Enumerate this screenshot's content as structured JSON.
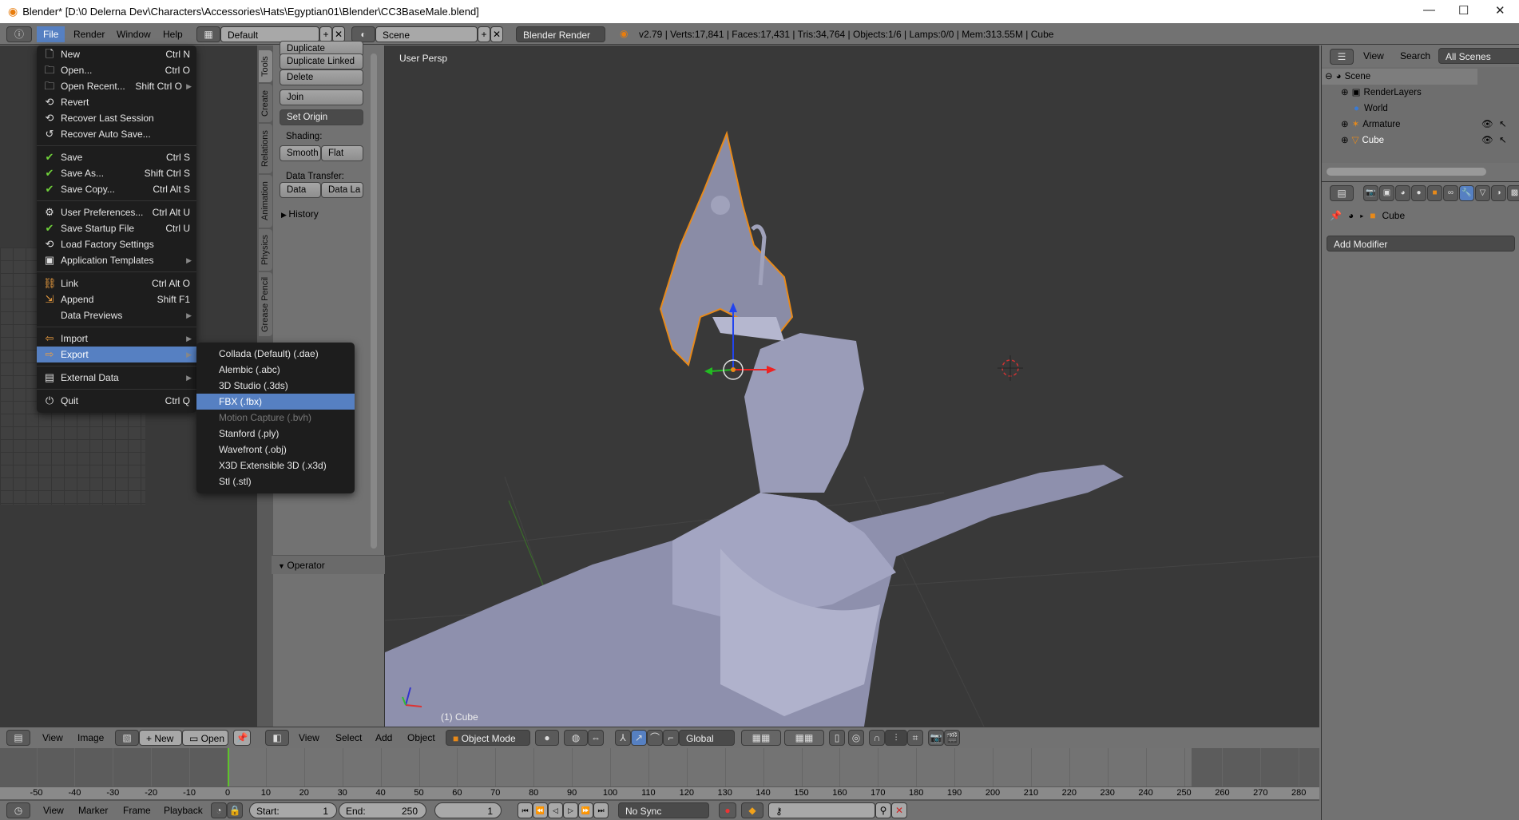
{
  "window": {
    "title": "Blender* [D:\\0 Delerna Dev\\Characters\\Accessories\\Hats\\Egyptian01\\Blender\\CC3BaseMale.blend]",
    "minimize": "—",
    "maximize": "☐",
    "close": "✕"
  },
  "menubar": {
    "items": [
      "File",
      "Render",
      "Window",
      "Help"
    ],
    "active": "File",
    "layout": "Default",
    "scene": "Scene",
    "engine": "Blender Render"
  },
  "stats": "v2.79 | Verts:17,841 | Faces:17,431 | Tris:34,764 | Objects:1/6 | Lamps:0/0 | Mem:313.55M | Cube",
  "file_menu": {
    "groups": [
      [
        {
          "label": "New",
          "shortcut": "Ctrl N",
          "icon": "new-file-icon"
        },
        {
          "label": "Open...",
          "shortcut": "Ctrl O",
          "icon": "folder-icon"
        },
        {
          "label": "Open Recent...",
          "shortcut": "Shift Ctrl O",
          "icon": "recent-icon",
          "submenu": true
        },
        {
          "label": "Revert",
          "shortcut": "",
          "icon": "revert-icon"
        },
        {
          "label": "Recover Last Session",
          "shortcut": "",
          "icon": "recover-icon"
        },
        {
          "label": "Recover Auto Save...",
          "shortcut": "",
          "icon": "recover-auto-icon"
        }
      ],
      [
        {
          "label": "Save",
          "shortcut": "Ctrl S",
          "icon": "check-icon"
        },
        {
          "label": "Save As...",
          "shortcut": "Shift Ctrl S",
          "icon": "check-icon"
        },
        {
          "label": "Save Copy...",
          "shortcut": "Ctrl Alt S",
          "icon": "check-icon"
        }
      ],
      [
        {
          "label": "User Preferences...",
          "shortcut": "Ctrl Alt U",
          "icon": "preferences-icon"
        },
        {
          "label": "Save Startup File",
          "shortcut": "Ctrl U",
          "icon": "save-startup-icon"
        },
        {
          "label": "Load Factory Settings",
          "shortcut": "",
          "icon": "factory-icon"
        },
        {
          "label": "Application Templates",
          "shortcut": "",
          "icon": "template-icon",
          "submenu": true
        }
      ],
      [
        {
          "label": "Link",
          "shortcut": "Ctrl Alt O",
          "icon": "link-icon"
        },
        {
          "label": "Append",
          "shortcut": "Shift F1",
          "icon": "append-icon"
        },
        {
          "label": "Data Previews",
          "shortcut": "",
          "icon": "",
          "submenu": true
        }
      ],
      [
        {
          "label": "Import",
          "shortcut": "",
          "icon": "import-icon",
          "submenu": true
        },
        {
          "label": "Export",
          "shortcut": "",
          "icon": "export-icon",
          "submenu": true,
          "selected": true
        }
      ],
      [
        {
          "label": "External Data",
          "shortcut": "",
          "icon": "external-data-icon",
          "submenu": true
        }
      ],
      [
        {
          "label": "Quit",
          "shortcut": "Ctrl Q",
          "icon": "power-icon"
        }
      ]
    ]
  },
  "export_menu": [
    {
      "label": "Collada (Default) (.dae)"
    },
    {
      "label": "Alembic (.abc)"
    },
    {
      "label": "3D Studio (.3ds)"
    },
    {
      "label": "FBX (.fbx)",
      "selected": true
    },
    {
      "label": "Motion Capture (.bvh)",
      "disabled": true
    },
    {
      "label": "Stanford (.ply)"
    },
    {
      "label": "Wavefront (.obj)"
    },
    {
      "label": "X3D Extensible 3D (.x3d)"
    },
    {
      "label": "Stl (.stl)"
    }
  ],
  "toolshelf": {
    "tabs": [
      "Tools",
      "Create",
      "Relations",
      "Animation",
      "Physics",
      "Grease Pencil"
    ],
    "duplicate": "Duplicate",
    "duplicate_linked": "Duplicate Linked",
    "delete": "Delete",
    "join": "Join",
    "set_origin": "Set Origin",
    "shading_label": "Shading:",
    "smooth": "Smooth",
    "flat": "Flat",
    "data_transfer_label": "Data Transfer:",
    "data": "Data",
    "data_layout": "Data La",
    "history": "History",
    "operator": "Operator"
  },
  "viewport": {
    "view_name": "User Persp",
    "object_label": "(1) Cube"
  },
  "outliner": {
    "view": "View",
    "search": "Search",
    "filter": "All Scenes",
    "rows": [
      {
        "label": "Scene",
        "icon": "scene-icon"
      },
      {
        "label": "RenderLayers",
        "icon": "render-layers-icon"
      },
      {
        "label": "World",
        "icon": "world-icon"
      },
      {
        "label": "Armature",
        "icon": "armature-icon"
      },
      {
        "label": "Cube",
        "icon": "mesh-icon"
      }
    ]
  },
  "properties": {
    "object": "Cube",
    "add_modifier": "Add Modifier",
    "active_tab": "modifiers"
  },
  "image_header": {
    "view": "View",
    "image": "Image",
    "new": "New",
    "open": "Open"
  },
  "view3d_header": {
    "view": "View",
    "select": "Select",
    "add": "Add",
    "object": "Object",
    "mode": "Object Mode",
    "orientation": "Global"
  },
  "timeline": {
    "ticks": [
      -50,
      -40,
      -30,
      -20,
      -10,
      0,
      10,
      20,
      30,
      40,
      50,
      60,
      70,
      80,
      90,
      100,
      110,
      120,
      130,
      140,
      150,
      160,
      170,
      180,
      190,
      200,
      210,
      220,
      230,
      240,
      250,
      260,
      270,
      280
    ],
    "current_frame": 1,
    "start_label": "Start:",
    "start": "1",
    "end_label": "End:",
    "end": "250",
    "frame": "1",
    "view": "View",
    "marker": "Marker",
    "frame_menu": "Frame",
    "playback": "Playback",
    "sync": "No Sync"
  },
  "colors": {
    "selection": "#5680c2",
    "highlight_outline": "#e88a1a",
    "frame_cursor": "#5ec32a"
  }
}
